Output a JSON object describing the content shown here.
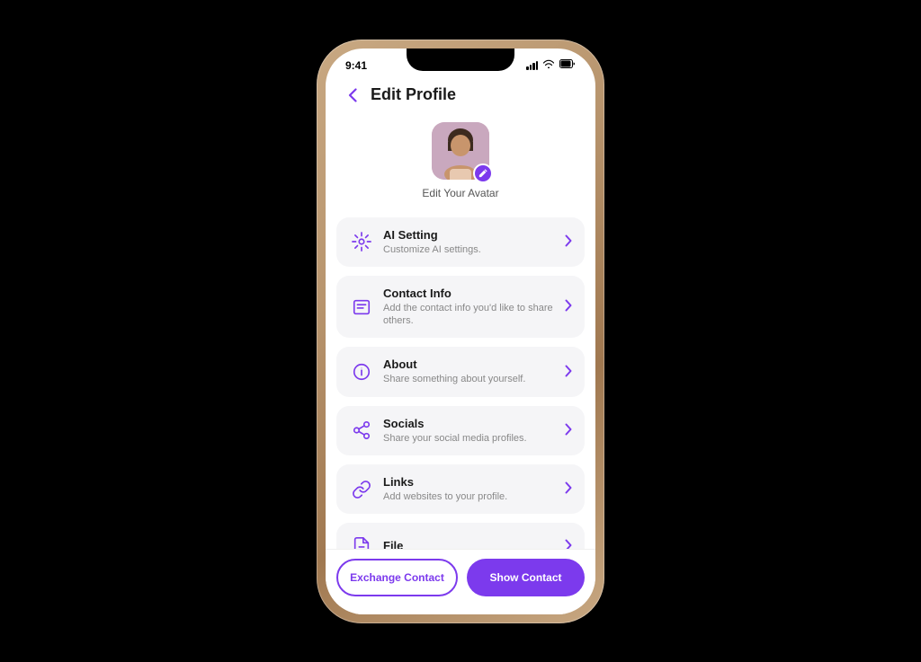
{
  "status": {
    "time": "9:41",
    "wifi": true,
    "battery": true
  },
  "header": {
    "back_label": "‹",
    "title": "Edit Profile"
  },
  "avatar": {
    "label": "Edit Your Avatar",
    "edit_icon": "✎"
  },
  "menu_items": [
    {
      "id": "ai-setting",
      "title": "AI Setting",
      "subtitle": "Customize AI settings.",
      "icon_type": "ai"
    },
    {
      "id": "contact-info",
      "title": "Contact Info",
      "subtitle": "Add the contact info you'd like to share others.",
      "icon_type": "contact"
    },
    {
      "id": "about",
      "title": "About",
      "subtitle": "Share something about yourself.",
      "icon_type": "about"
    },
    {
      "id": "socials",
      "title": "Socials",
      "subtitle": "Share your social media profiles.",
      "icon_type": "socials"
    },
    {
      "id": "links",
      "title": "Links",
      "subtitle": "Add websites to your profile.",
      "icon_type": "links"
    },
    {
      "id": "file",
      "title": "File",
      "subtitle": "",
      "icon_type": "file"
    }
  ],
  "bottom": {
    "exchange_label": "Exchange Contact",
    "show_label": "Show Contact"
  },
  "colors": {
    "accent": "#7c3aed",
    "card_bg": "#f5f5f7",
    "text_primary": "#1a1a1a",
    "text_secondary": "#888"
  }
}
